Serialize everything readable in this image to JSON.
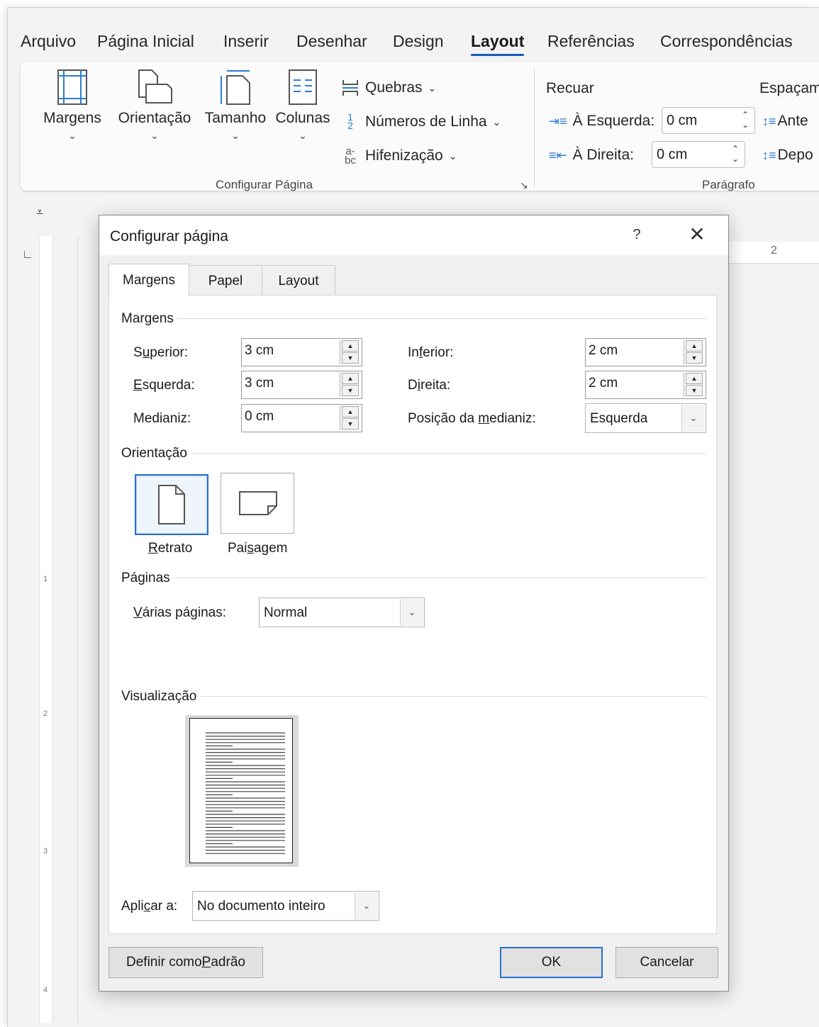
{
  "menu": {
    "tabs": [
      "Arquivo",
      "Página Inicial",
      "Inserir",
      "Desenhar",
      "Design",
      "Layout",
      "Referências",
      "Correspondências"
    ],
    "active": "Layout"
  },
  "ribbon": {
    "page_setup": {
      "margins": "Margens",
      "orientation": "Orientação",
      "size": "Tamanho",
      "columns": "Colunas",
      "breaks": "Quebras",
      "line_numbers": "Números de Linha",
      "hyphenation": "Hifenização",
      "group_label": "Configurar Página"
    },
    "paragraph": {
      "indent_title": "Recuar",
      "spacing_title": "Espaçam",
      "left_label": "À Esquerda:",
      "left_value": "0 cm",
      "right_label": "À Direita:",
      "right_value": "0 cm",
      "before_label": "Ante",
      "after_label": "Depo",
      "group_label": "Parágrafo"
    }
  },
  "ruler": {
    "h_number": "2",
    "v_numbers": [
      "1",
      "2",
      "3",
      "4"
    ]
  },
  "dialog": {
    "title": "Configurar página",
    "help": "?",
    "close": "✕",
    "tabs": [
      "Margens",
      "Papel",
      "Layout"
    ],
    "active_tab": "Margens",
    "margins": {
      "section": "Margens",
      "top_label_pre": "S",
      "top_label_u": "u",
      "top_label_post": "perior:",
      "top_value": "3 cm",
      "left_label_u": "E",
      "left_label_post": "squerda:",
      "left_value": "3 cm",
      "gutter_label_pre": "Medianiz",
      "gutter_label_u": "",
      "gutter_label_post": ":",
      "gutter_value": "0 cm",
      "bottom_label_pre": "In",
      "bottom_label_u": "f",
      "bottom_label_post": "erior:",
      "bottom_value": "2 cm",
      "right_label_pre": "D",
      "right_label_u": "i",
      "right_label_post": "reita:",
      "right_value": "2 cm",
      "gutter_pos_label_pre": "Posição da ",
      "gutter_pos_label_u": "m",
      "gutter_pos_label_post": "edianiz:",
      "gutter_pos_value": "Esquerda"
    },
    "orientation": {
      "section": "Orientação",
      "portrait_u": "R",
      "portrait_post": "etrato",
      "landscape_pre": "Pai",
      "landscape_u": "s",
      "landscape_post": "agem",
      "selected": "portrait"
    },
    "pages": {
      "section": "Páginas",
      "multi_label_u": "V",
      "multi_label_post": "árias páginas:",
      "multi_value": "Normal"
    },
    "preview": {
      "section": "Visualização"
    },
    "apply": {
      "label_pre": "Apli",
      "label_u": "c",
      "label_post": "ar a:",
      "value": "No documento inteiro"
    },
    "buttons": {
      "set_default_pre": "Definir como ",
      "set_default_u": "P",
      "set_default_post": "adrão",
      "ok": "OK",
      "cancel": "Cancelar"
    }
  },
  "colors": {
    "accent": "#185abd",
    "focus": "#2a6fd0"
  }
}
